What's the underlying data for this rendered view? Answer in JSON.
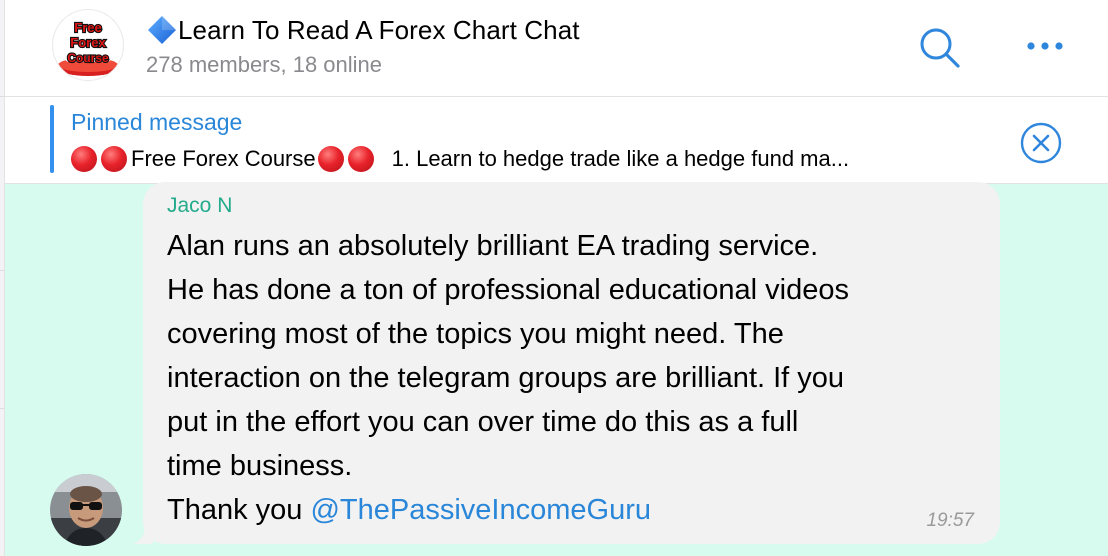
{
  "chat": {
    "title": "Learn To Read A Forex Chart Chat",
    "members": "278 members, 18 online",
    "avatar_text": [
      "Free",
      "Forex",
      "Course"
    ]
  },
  "pinned": {
    "label": "Pinned message",
    "course_name": "Free Forex Course",
    "text": "1. Learn to hedge trade like a hedge fund ma..."
  },
  "message": {
    "sender": "Jaco N",
    "lines": [
      "Alan runs an absolutely brilliant EA trading service.",
      "He has done a ton of professional educational videos",
      "covering most of the topics you might need. The",
      "interaction on the telegram groups are brilliant. If you",
      "put in the effort you can over time do this as a full",
      "time business."
    ],
    "closing": "Thank you",
    "mention": "@ThePassiveIncomeGuru",
    "time": "19:57"
  },
  "icons": {
    "title_prefix": "blue-diamond-icon",
    "search": "search-icon",
    "more": "more-dots-icon",
    "close_pinned": "close-circle-icon",
    "pin_emoji": "red-circle-icon"
  },
  "colors": {
    "accent": "#3390ec",
    "chat_background": "#d7fbef",
    "bubble": "#f2f2f2",
    "sender_name": "#23ab8c",
    "mention": "#2a86d8"
  }
}
